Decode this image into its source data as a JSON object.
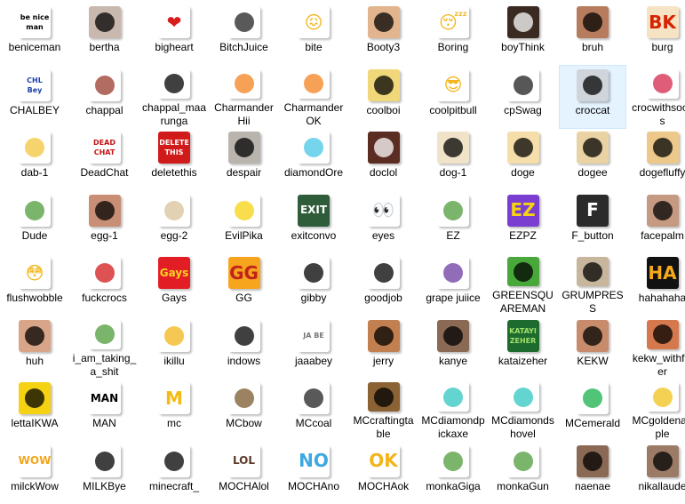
{
  "files": [
    {
      "label": "beniceman",
      "icon": "be-nice-man-text-icon",
      "glyph": "be nice man",
      "bg": "#ffffff",
      "fg": "#000000"
    },
    {
      "label": "bertha",
      "icon": "old-woman-photo-icon",
      "glyph": "",
      "bg": "#c9b8ad",
      "fg": "#000000"
    },
    {
      "label": "bigheart",
      "icon": "red-heart-icon",
      "glyph": "❤",
      "bg": "#ffffff",
      "fg": "#d81b1b"
    },
    {
      "label": "BitchJuice",
      "icon": "bottle-icon",
      "glyph": "",
      "bg": "#ffffff",
      "fg": "#222222"
    },
    {
      "label": "bite",
      "icon": "grimace-emoji-icon",
      "glyph": "😖",
      "bg": "#ffffff",
      "fg": "#f2b51a"
    },
    {
      "label": "Booty3",
      "icon": "booty-icon",
      "glyph": "",
      "bg": "#e2b58e",
      "fg": "#000000"
    },
    {
      "label": "Boring",
      "icon": "sleepy-emoji-icon",
      "glyph": "😴",
      "bg": "#ffffff",
      "fg": "#f2b51a"
    },
    {
      "label": "boyThink",
      "icon": "thinking-boy-icon",
      "glyph": "",
      "bg": "#3b2a22",
      "fg": "#ffffff"
    },
    {
      "label": "bruh",
      "icon": "kid-face-icon",
      "glyph": "",
      "bg": "#b67c5d",
      "fg": "#000000"
    },
    {
      "label": "burg",
      "icon": "burger-king-logo-icon",
      "glyph": "BK",
      "bg": "#f5e3c3",
      "fg": "#d62300"
    },
    {
      "label": "CHALBEY",
      "icon": "chalbey-text-icon",
      "glyph": "CHL Bey",
      "bg": "#ffffff",
      "fg": "#1b3fa8"
    },
    {
      "label": "chappal",
      "icon": "sandal-icon",
      "glyph": "",
      "bg": "#ffffff",
      "fg": "#9a3b2c"
    },
    {
      "label": "chappal_maarunga",
      "icon": "stick-figure-icon",
      "glyph": "",
      "bg": "#ffffff",
      "fg": "#000000"
    },
    {
      "label": "CharmanderHii",
      "icon": "charmander-icon",
      "glyph": "",
      "bg": "#ffffff",
      "fg": "#f4811f"
    },
    {
      "label": "CharmanderOK",
      "icon": "charmander-ok-icon",
      "glyph": "",
      "bg": "#ffffff",
      "fg": "#f4811f"
    },
    {
      "label": "coolboi",
      "icon": "cool-cartoon-icon",
      "glyph": "",
      "bg": "#f0d87a",
      "fg": "#000000"
    },
    {
      "label": "coolpitbull",
      "icon": "sunglasses-emoji-icon",
      "glyph": "😎",
      "bg": "#ffffff",
      "fg": "#f2b51a"
    },
    {
      "label": "cpSwag",
      "icon": "penguin-icon",
      "glyph": "",
      "bg": "#ffffff",
      "fg": "#1f1f1f"
    },
    {
      "label": "croccat",
      "icon": "croc-cat-icon",
      "glyph": "",
      "bg": "#cfd5db",
      "fg": "#000000"
    },
    {
      "label": "crocwithsocks",
      "icon": "croc-shoe-icon",
      "glyph": "",
      "bg": "#ffffff",
      "fg": "#d6274c"
    },
    {
      "label": "dab-1",
      "icon": "dab-emoji-icon",
      "glyph": "",
      "bg": "#ffffff",
      "fg": "#f2c53d"
    },
    {
      "label": "DeadChat",
      "icon": "dead-chat-text-icon",
      "glyph": "DEAD CHAT",
      "bg": "#ffffff",
      "fg": "#c41414"
    },
    {
      "label": "deletethis",
      "icon": "delete-this-text-icon",
      "glyph": "DELETE THIS",
      "bg": "#d11a1a",
      "fg": "#ffffff"
    },
    {
      "label": "despair",
      "icon": "crying-cat-icon",
      "glyph": "",
      "bg": "#b9b5ae",
      "fg": "#000000"
    },
    {
      "label": "diamondOre",
      "icon": "diamond-ore-icon",
      "glyph": "",
      "bg": "#ffffff",
      "fg": "#46c7e6"
    },
    {
      "label": "doclol",
      "icon": "doctor-photo-icon",
      "glyph": "",
      "bg": "#5a2c22",
      "fg": "#ffffff"
    },
    {
      "label": "dog-1",
      "icon": "dog-face-icon",
      "glyph": "",
      "bg": "#f0e3c9",
      "fg": "#000000"
    },
    {
      "label": "doge",
      "icon": "doge-icon",
      "glyph": "",
      "bg": "#f6deaa",
      "fg": "#000000"
    },
    {
      "label": "dogee",
      "icon": "doge-sketch-icon",
      "glyph": "",
      "bg": "#e9d3a4",
      "fg": "#000000"
    },
    {
      "label": "dogefluffy",
      "icon": "fluffy-doge-icon",
      "glyph": "",
      "bg": "#ecc98a",
      "fg": "#000000"
    },
    {
      "label": "Dude",
      "icon": "pepe-frog-icon",
      "glyph": "",
      "bg": "#ffffff",
      "fg": "#4f9b3a"
    },
    {
      "label": "egg-1",
      "icon": "man-face-icon",
      "glyph": "",
      "bg": "#c98f76",
      "fg": "#000000"
    },
    {
      "label": "egg-2",
      "icon": "egg-icon",
      "glyph": "",
      "bg": "#ffffff",
      "fg": "#d8c19a"
    },
    {
      "label": "EvilPika",
      "icon": "evil-pikachu-icon",
      "glyph": "",
      "bg": "#ffffff",
      "fg": "#f5d312"
    },
    {
      "label": "exitconvo",
      "icon": "exit-door-icon",
      "glyph": "EXIT",
      "bg": "#2f5d3a",
      "fg": "#ffffff"
    },
    {
      "label": "eyes",
      "icon": "eyes-icon",
      "glyph": "👀",
      "bg": "#ffffff",
      "fg": "#000000"
    },
    {
      "label": "EZ",
      "icon": "pepe-ez-icon",
      "glyph": "",
      "bg": "#ffffff",
      "fg": "#4f9b3a"
    },
    {
      "label": "EZPZ",
      "icon": "ez-text-icon",
      "glyph": "EZ",
      "bg": "#7a3fd1",
      "fg": "#f5d312"
    },
    {
      "label": "F_button",
      "icon": "f-key-icon",
      "glyph": "F",
      "bg": "#2b2b2b",
      "fg": "#ffffff"
    },
    {
      "label": "facepalm",
      "icon": "facepalm-icon",
      "glyph": "",
      "bg": "#c69a82",
      "fg": "#000000"
    },
    {
      "label": "flushwobble",
      "icon": "flushed-emoji-icon",
      "glyph": "😳",
      "bg": "#ffffff",
      "fg": "#f2b51a"
    },
    {
      "label": "fuckcrocs",
      "icon": "no-sign-icon",
      "glyph": "",
      "bg": "#ffffff",
      "fg": "#d11a1a"
    },
    {
      "label": "Gays",
      "icon": "chips-bag-icon",
      "glyph": "Gays",
      "bg": "#e21d24",
      "fg": "#f9d423"
    },
    {
      "label": "GG",
      "icon": "gg-text-icon",
      "glyph": "GG",
      "bg": "#f7a51c",
      "fg": "#c0231e"
    },
    {
      "label": "gibby",
      "icon": "gibby-photo-icon",
      "glyph": "",
      "bg": "#ffffff",
      "fg": "#000000"
    },
    {
      "label": "goodjob",
      "icon": "thumbs-up-photo-icon",
      "glyph": "",
      "bg": "#ffffff",
      "fg": "#000000"
    },
    {
      "label": "grape juiice",
      "icon": "juice-box-icon",
      "glyph": "",
      "bg": "#ffffff",
      "fg": "#6c3ca1"
    },
    {
      "label": "GREENSQUAREMAN",
      "icon": "creeper-icon",
      "glyph": "",
      "bg": "#49a83a",
      "fg": "#000000"
    },
    {
      "label": "GRUMPRESS",
      "icon": "grumpy-cat-icon",
      "glyph": "",
      "bg": "#c7b59c",
      "fg": "#000000"
    },
    {
      "label": "hahahaha",
      "icon": "ha-text-icon",
      "glyph": "HA",
      "bg": "#111111",
      "fg": "#f6a91b"
    },
    {
      "label": "huh",
      "icon": "baby-face-icon",
      "glyph": "",
      "bg": "#d9a588",
      "fg": "#000000"
    },
    {
      "label": "i_am_taking_a_shit",
      "icon": "pepe-toilet-icon",
      "glyph": "",
      "bg": "#ffffff",
      "fg": "#4f9b3a"
    },
    {
      "label": "ikillu",
      "icon": "gun-emoji-icon",
      "glyph": "",
      "bg": "#ffffff",
      "fg": "#f2b51a"
    },
    {
      "label": "indows",
      "icon": "windows-logo-icon",
      "glyph": "",
      "bg": "#ffffff",
      "fg": "#000000"
    },
    {
      "label": "jaaabey",
      "icon": "jaabey-text-icon",
      "glyph": "JA BE",
      "bg": "#ffffff",
      "fg": "#777777"
    },
    {
      "label": "jerry",
      "icon": "jerry-face-icon",
      "glyph": "",
      "bg": "#c27f4f",
      "fg": "#000000"
    },
    {
      "label": "kanye",
      "icon": "kanye-photo-icon",
      "glyph": "",
      "bg": "#8a6a55",
      "fg": "#000000"
    },
    {
      "label": "kataizeher",
      "icon": "kataizeher-text-icon",
      "glyph": "KATAYI ZEHER",
      "bg": "#1d6b2e",
      "fg": "#9fe06a"
    },
    {
      "label": "KEKW",
      "icon": "kekw-laugh-icon",
      "glyph": "",
      "bg": "#c88b6b",
      "fg": "#000000"
    },
    {
      "label": "kekw_withfilter",
      "icon": "kekw-filter-icon",
      "glyph": "",
      "bg": "#d6784d",
      "fg": "#000000"
    },
    {
      "label": "lettaIKWA",
      "icon": "pikachu-cry-icon",
      "glyph": "",
      "bg": "#f5d312",
      "fg": "#000000"
    },
    {
      "label": "MAN",
      "icon": "man-text-icon",
      "glyph": "MAN",
      "bg": "#ffffff",
      "fg": "#000000"
    },
    {
      "label": "mc",
      "icon": "mcdonalds-logo-icon",
      "glyph": "M",
      "bg": "#ffffff",
      "fg": "#f6bb12"
    },
    {
      "label": "MCbow",
      "icon": "minecraft-bow-icon",
      "glyph": "",
      "bg": "#ffffff",
      "fg": "#7a5a2c"
    },
    {
      "label": "MCcoal",
      "icon": "minecraft-coal-icon",
      "glyph": "",
      "bg": "#ffffff",
      "fg": "#222222"
    },
    {
      "label": "MCcraftingtable",
      "icon": "crafting-table-icon",
      "glyph": "",
      "bg": "#8b6234",
      "fg": "#000000"
    },
    {
      "label": "MCdiamondpickaxe",
      "icon": "diamond-pickaxe-icon",
      "glyph": "",
      "bg": "#ffffff",
      "fg": "#2fc6c0"
    },
    {
      "label": "MCdiamondshovel",
      "icon": "diamond-shovel-icon",
      "glyph": "",
      "bg": "#ffffff",
      "fg": "#2fc6c0"
    },
    {
      "label": "MCemerald",
      "icon": "emerald-icon",
      "glyph": "",
      "bg": "#ffffff",
      "fg": "#17b04a"
    },
    {
      "label": "MCgoldenapple",
      "icon": "golden-apple-icon",
      "glyph": "",
      "bg": "#ffffff",
      "fg": "#f2c21a"
    },
    {
      "label": "milckWow",
      "icon": "wow-sticker-icon",
      "glyph": "WOW",
      "bg": "#ffffff",
      "fg": "#f2a51a"
    },
    {
      "label": "MILKBye",
      "icon": "milk-bear-icon",
      "glyph": "",
      "bg": "#ffffff",
      "fg": "#000000"
    },
    {
      "label": "minecraft_",
      "icon": "minecraft-icon",
      "glyph": "",
      "bg": "#ffffff",
      "fg": "#000000"
    },
    {
      "label": "MOCHAlol",
      "icon": "mocha-lol-icon",
      "glyph": "LOL",
      "bg": "#ffffff",
      "fg": "#5a3b2a"
    },
    {
      "label": "MOCHAno",
      "icon": "mocha-no-icon",
      "glyph": "NO",
      "bg": "#ffffff",
      "fg": "#3ea8e0"
    },
    {
      "label": "MOCHAok",
      "icon": "mocha-ok-icon",
      "glyph": "OK",
      "bg": "#ffffff",
      "fg": "#f2b51a"
    },
    {
      "label": "monkaGiga",
      "icon": "monka-giga-icon",
      "glyph": "",
      "bg": "#ffffff",
      "fg": "#4f9b3a"
    },
    {
      "label": "monkaGun",
      "icon": "monka-gun-icon",
      "glyph": "",
      "bg": "#ffffff",
      "fg": "#4f9b3a"
    },
    {
      "label": "naenae",
      "icon": "naenae-photo-icon",
      "glyph": "",
      "bg": "#8a6a55",
      "fg": "#000000"
    },
    {
      "label": "nikallaude",
      "icon": "nikal-photo-icon",
      "glyph": "",
      "bg": "#9c7b66",
      "fg": "#000000"
    }
  ],
  "selected_label": "croccat"
}
